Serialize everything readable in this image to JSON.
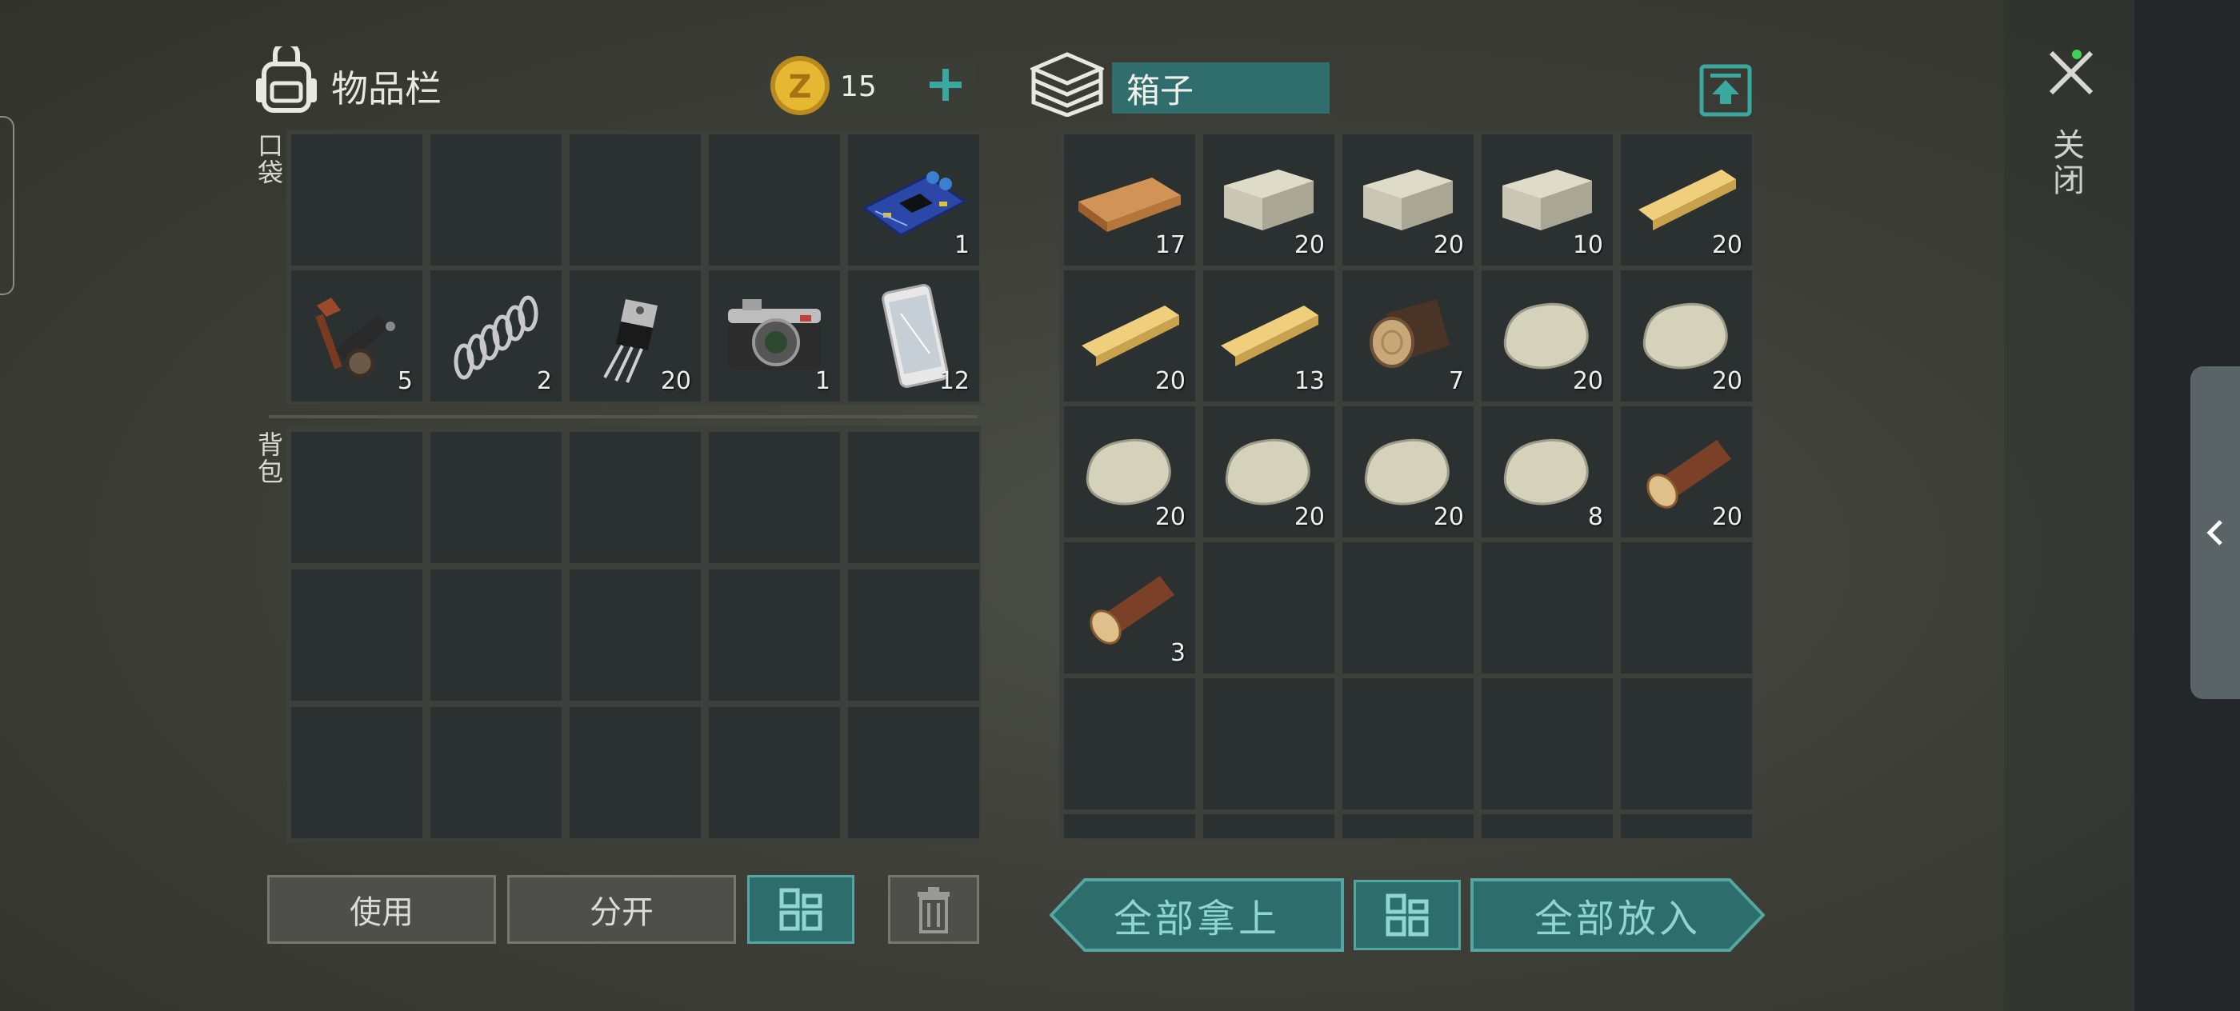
{
  "inventory": {
    "title": "物品栏",
    "coins": "15",
    "pocket_label": "口袋",
    "backpack_label": "背包",
    "pocket_items": [
      {
        "icon": "empty",
        "count": ""
      },
      {
        "icon": "empty",
        "count": ""
      },
      {
        "icon": "empty",
        "count": ""
      },
      {
        "icon": "empty",
        "count": ""
      },
      {
        "icon": "circuit-board",
        "count": "1"
      },
      {
        "icon": "gun-parts",
        "count": "5"
      },
      {
        "icon": "spring",
        "count": "2"
      },
      {
        "icon": "transistor",
        "count": "20"
      },
      {
        "icon": "camera",
        "count": "1"
      },
      {
        "icon": "smartphone",
        "count": "12"
      }
    ],
    "buttons": {
      "use": "使用",
      "split": "分开"
    }
  },
  "chest": {
    "title": "箱子",
    "items": [
      {
        "icon": "wood-plank",
        "count": "17"
      },
      {
        "icon": "stone-block",
        "count": "20"
      },
      {
        "icon": "stone-block",
        "count": "20"
      },
      {
        "icon": "stone-block",
        "count": "10"
      },
      {
        "icon": "wood-plank-light",
        "count": "20"
      },
      {
        "icon": "wood-plank-light",
        "count": "20"
      },
      {
        "icon": "wood-plank-light",
        "count": "13"
      },
      {
        "icon": "log-dark",
        "count": "7"
      },
      {
        "icon": "stone",
        "count": "20"
      },
      {
        "icon": "stone",
        "count": "20"
      },
      {
        "icon": "stone",
        "count": "20"
      },
      {
        "icon": "stone",
        "count": "20"
      },
      {
        "icon": "stone",
        "count": "20"
      },
      {
        "icon": "stone",
        "count": "8"
      },
      {
        "icon": "log",
        "count": "20"
      },
      {
        "icon": "log",
        "count": "3"
      }
    ],
    "buttons": {
      "take_all": "全部拿上",
      "put_all": "全部放入"
    }
  },
  "close_label": "关闭",
  "colors": {
    "accent": "#2d6d6c",
    "accent_border": "#55a6a1",
    "accent_text": "#8fd6cf",
    "slot": "#2b3031"
  }
}
